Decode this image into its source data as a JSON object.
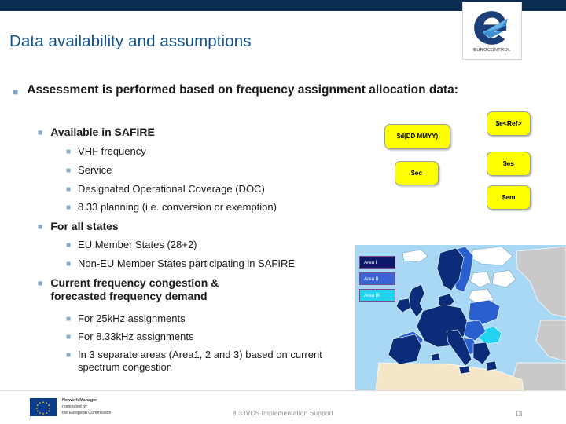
{
  "theme": {
    "topbar_color": "#0b2d52",
    "title_color": "#12538f",
    "bullet_marker_color": "#7fa8c9",
    "callout_fill": "#ffff00",
    "callout_border": "#9aa39a",
    "area1_color": "#0b1a6b",
    "area2_color": "#3a63d6",
    "area3_color": "#22d3f0",
    "sea_color": "#a9d8f5",
    "map_outside_color": "#c9c9c9"
  },
  "header": {
    "title": "Data availability and assumptions",
    "logo_wordmark": "EUROCONTROL"
  },
  "content": {
    "bullets": [
      {
        "level": 1,
        "marker": "bullet-square",
        "text": "Assessment is performed based on frequency assignment allocation data:"
      },
      {
        "level": 2,
        "marker": "bullet-square",
        "text": "Available in SAFIRE"
      },
      {
        "level": 3,
        "marker": "bullet-square",
        "text": "VHF frequency"
      },
      {
        "level": 3,
        "marker": "bullet-square",
        "text": "Service"
      },
      {
        "level": 3,
        "marker": "bullet-square",
        "text": "Designated Operational Coverage (DOC)"
      },
      {
        "level": 3,
        "marker": "bullet-square",
        "text": "8.33 planning (i.e. conversion or exemption)"
      },
      {
        "level": 2,
        "marker": "bullet-square",
        "text": "For all states"
      },
      {
        "level": 3,
        "marker": "bullet-square",
        "text": "EU Member States (28+2)"
      },
      {
        "level": 3,
        "marker": "bullet-square",
        "text": "Non-EU Member States participating in SAFIRE"
      },
      {
        "level": 2,
        "marker": "bullet-square",
        "text": "Current frequency congestion & forecasted frequency demand"
      },
      {
        "level": 3,
        "marker": "bullet-square",
        "text": "For 25kHz assignments"
      },
      {
        "level": 3,
        "marker": "bullet-square",
        "text": "For 8.33kHz assignments"
      },
      {
        "level": 3,
        "marker": "bullet-square",
        "text": "In 3 separate areas (Area1, 2 and 3) based on current spectrum congestion"
      }
    ]
  },
  "callouts": [
    {
      "id": "callout-date",
      "label": "$d(DD MMYY)"
    },
    {
      "id": "callout-ref",
      "label": "$e<Ref>"
    },
    {
      "id": "callout-ec",
      "label": "$ec"
    },
    {
      "id": "callout-es",
      "label": "$es"
    },
    {
      "id": "callout-em",
      "label": "$em"
    }
  ],
  "map": {
    "legend": [
      {
        "label": "Area I",
        "color": "#0b1a6b"
      },
      {
        "label": "Area II",
        "color": "#3a63d6"
      },
      {
        "label": "Area III",
        "color": "#22d3f0"
      }
    ]
  },
  "footer": {
    "eu_line1": "Network Manager",
    "eu_line2": "nominated by",
    "eu_line3": "the European Commission",
    "center_text": "8.33VCS Implementation Support",
    "page_number": "13"
  }
}
